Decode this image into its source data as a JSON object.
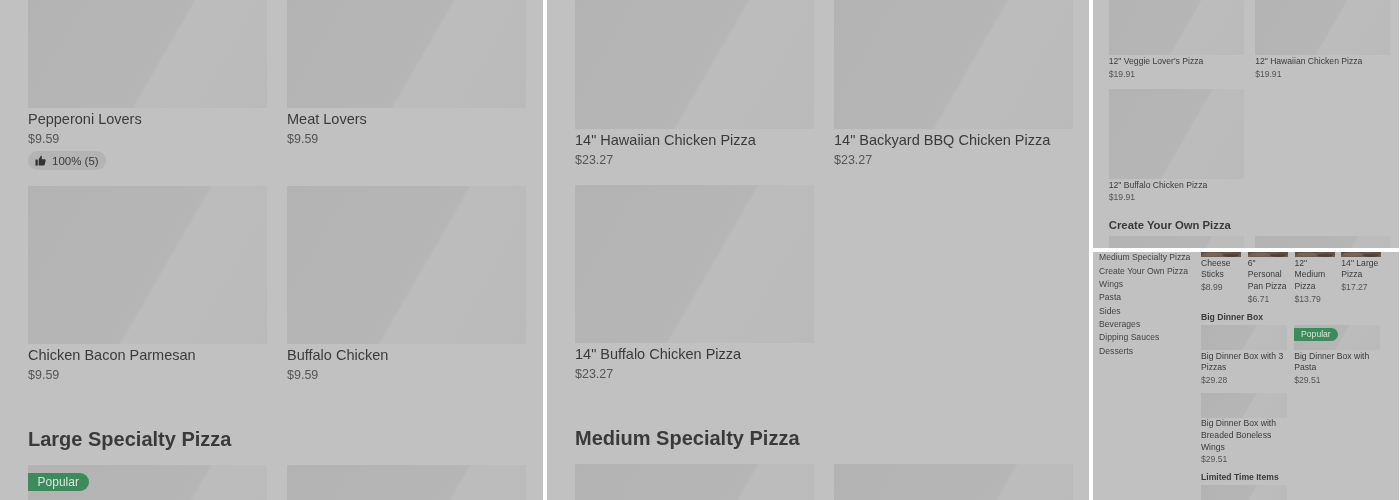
{
  "panels": [
    {
      "groups": [
        {
          "items": [
            {
              "kind": "placeholder",
              "name": "Pepperoni Lovers",
              "price": "$9.59",
              "rating": "100% (5)"
            },
            {
              "kind": "placeholder",
              "name": "Meat Lovers",
              "price": "$9.59"
            },
            {
              "kind": "placeholder",
              "name": "Chicken Bacon Parmesan",
              "price": "$9.59"
            },
            {
              "kind": "placeholder",
              "name": "Buffalo Chicken",
              "price": "$9.59"
            }
          ]
        },
        {
          "heading": "Large Specialty Pizza",
          "items": [
            {
              "kind": "placeholder",
              "badge": "Popular"
            },
            {
              "kind": "placeholder"
            }
          ]
        }
      ]
    },
    {
      "groups": [
        {
          "items": [
            {
              "kind": "placeholder",
              "name": "14\" Hawaiian Chicken Pizza",
              "price": "$23.27"
            },
            {
              "kind": "placeholder",
              "name": "14\" Backyard BBQ Chicken Pizza",
              "price": "$23.27"
            },
            {
              "kind": "placeholder",
              "name": "14\" Buffalo Chicken Pizza",
              "price": "$23.27"
            }
          ]
        },
        {
          "heading": "Medium Specialty Pizza",
          "items": [
            {
              "kind": "placeholder"
            },
            {
              "kind": "placeholder"
            }
          ]
        }
      ]
    },
    {
      "groups": [
        {
          "items": [
            {
              "kind": "placeholder",
              "name": "12\" Veggie Lover's Pizza",
              "price": "$19.91"
            },
            {
              "kind": "placeholder",
              "name": "12\" Hawaiian Chicken Pizza",
              "price": "$19.91"
            },
            {
              "kind": "placeholder",
              "name": "12\" Buffalo Chicken Pizza",
              "price": "$19.91"
            }
          ]
        },
        {
          "heading": "Create Your Own Pizza",
          "items": [
            {
              "kind": "placeholder"
            },
            {
              "kind": "placeholder"
            }
          ]
        }
      ]
    },
    {
      "sidebar": [
        "Medium Specialty Pizza",
        "Create Your Own Pizza",
        "Wings",
        "Pasta",
        "Sides",
        "Beverages",
        "Dipping Sauces",
        "Desserts"
      ],
      "groups": [
        {
          "items": [
            {
              "name": "Cheese Sticks",
              "price": "$8.99"
            },
            {
              "name": "6\" Personal Pan Pizza",
              "price": "$6.71"
            },
            {
              "name": "12\" Medium Pizza",
              "price": "$13.79"
            },
            {
              "name": "14\" Large Pizza",
              "price": "$17.27"
            }
          ]
        },
        {
          "heading": "Big Dinner Box",
          "items": [
            {
              "kind": "placeholder",
              "name": "Big Dinner Box with 3 Pizzas",
              "price": "$29.28"
            },
            {
              "kind": "placeholder",
              "badge": "Popular",
              "name": "Big Dinner Box with Pasta",
              "price": "$29.51"
            },
            {
              "kind": "placeholder",
              "name": "Big Dinner Box with Breaded Boneless Wings",
              "price": "$29.51"
            }
          ]
        },
        {
          "heading": "Limited Time Items",
          "items": [
            {
              "kind": "placeholder"
            }
          ]
        }
      ]
    }
  ]
}
